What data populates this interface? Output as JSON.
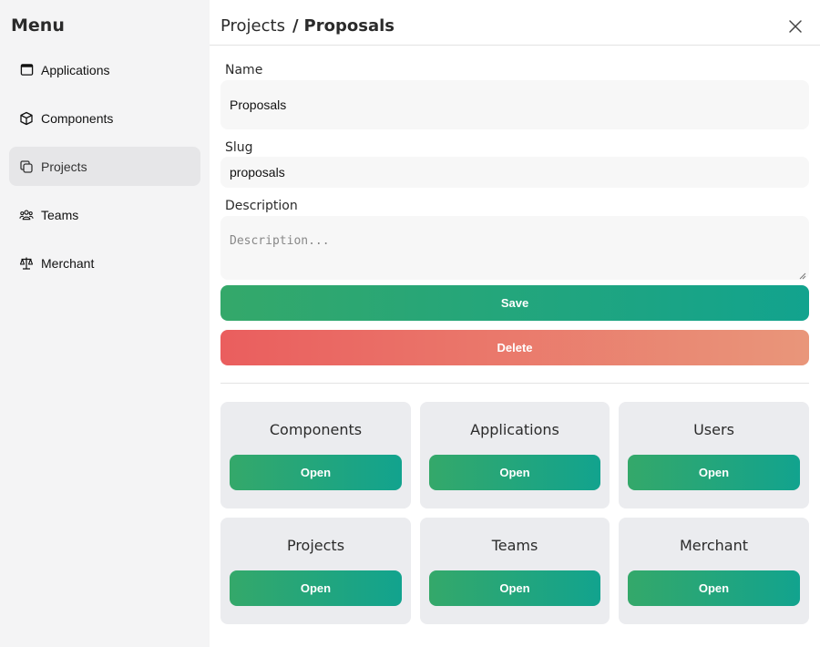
{
  "sidebar": {
    "title": "Menu",
    "items": [
      {
        "label": "Applications",
        "icon": "window-icon"
      },
      {
        "label": "Components",
        "icon": "cube-icon"
      },
      {
        "label": "Projects",
        "icon": "copy-icon",
        "active": true
      },
      {
        "label": "Teams",
        "icon": "users-icon"
      },
      {
        "label": "Merchant",
        "icon": "scale-icon"
      }
    ]
  },
  "header": {
    "crumb_parent": "Projects",
    "crumb_separator": "/",
    "crumb_current": "Proposals",
    "close_icon": "close-icon"
  },
  "form": {
    "name_label": "Name",
    "name_value": "Proposals",
    "slug_label": "Slug",
    "slug_value": "proposals",
    "description_label": "Description",
    "description_placeholder": "Description...",
    "save_label": "Save",
    "delete_label": "Delete"
  },
  "cards": [
    {
      "title": "Components",
      "button": "Open"
    },
    {
      "title": "Applications",
      "button": "Open"
    },
    {
      "title": "Users",
      "button": "Open"
    },
    {
      "title": "Projects",
      "button": "Open"
    },
    {
      "title": "Teams",
      "button": "Open"
    },
    {
      "title": "Merchant",
      "button": "Open"
    }
  ],
  "colors": {
    "save_gradient": [
      "#34a86a",
      "#12a38e"
    ],
    "delete_gradient": [
      "#ea5e5e",
      "#e9967a"
    ],
    "sidebar_bg": "#f4f4f5",
    "card_bg": "#ebecef"
  }
}
